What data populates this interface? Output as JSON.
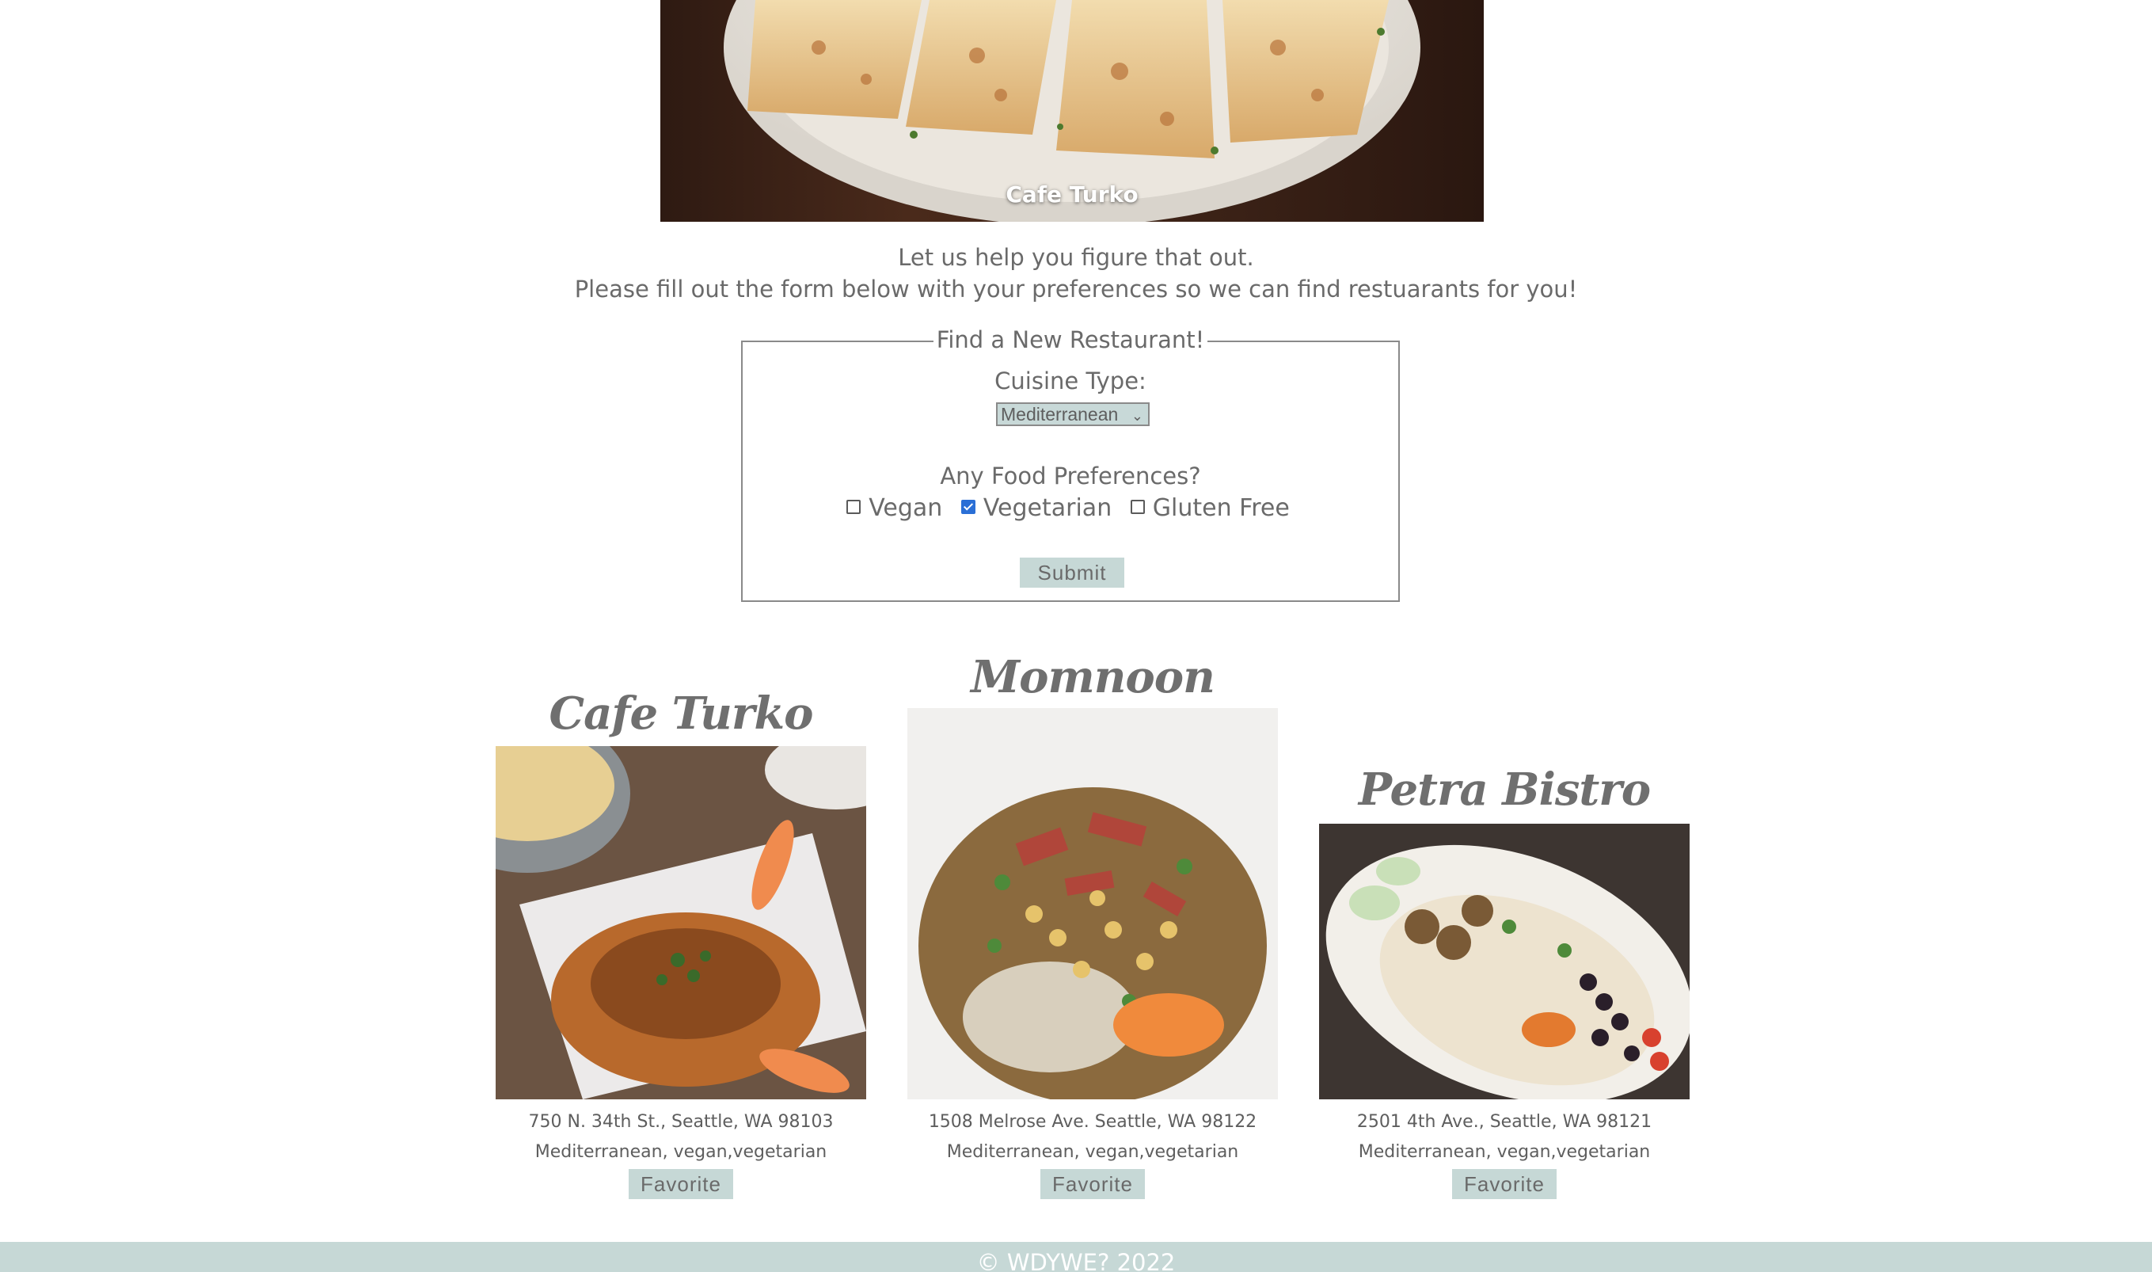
{
  "hero": {
    "caption": "Cafe Turko"
  },
  "intro": {
    "line1": "Let us help you figure that out.",
    "line2": "Please fill out the form below with your preferences so we can find restuarants for you!"
  },
  "form": {
    "legend": "Find a New Restaurant!",
    "cuisine_label": "Cuisine Type:",
    "cuisine_selected": "Mediterranean",
    "prefs_label": "Any Food Preferences?",
    "options": [
      {
        "label": "Vegan",
        "checked": false
      },
      {
        "label": "Vegetarian",
        "checked": true
      },
      {
        "label": "Gluten Free",
        "checked": false
      }
    ],
    "submit_label": "Submit"
  },
  "cards": [
    {
      "name": "Cafe Turko",
      "address": "750 N. 34th St., Seattle, WA 98103",
      "tags": "Mediterranean, vegan,vegetarian",
      "favorite_label": "Favorite"
    },
    {
      "name": "Momnoon",
      "address": "1508 Melrose Ave. Seattle, WA 98122",
      "tags": "Mediterranean, vegan,vegetarian",
      "favorite_label": "Favorite"
    },
    {
      "name": "Petra Bistro",
      "address": "2501 4th Ave., Seattle, WA 98121",
      "tags": "Mediterranean, vegan,vegetarian",
      "favorite_label": "Favorite"
    }
  ],
  "footer": {
    "text": "© WDYWE? 2022"
  },
  "colors": {
    "accent": "#c6d8d6",
    "text": "#5e5e5e",
    "checkbox_checked": "#2a6fd6"
  }
}
